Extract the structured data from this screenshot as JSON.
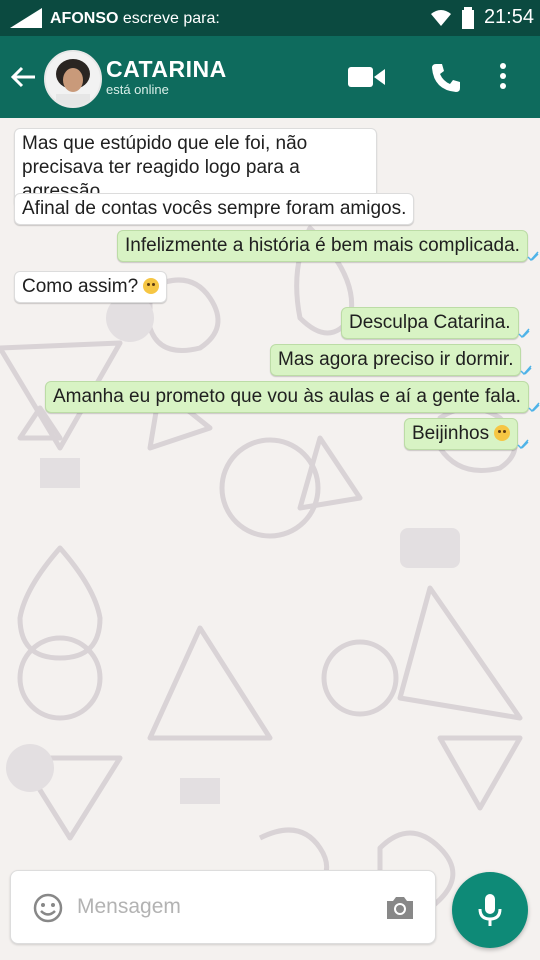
{
  "status_bar": {
    "writer_name": "AFONSO",
    "writer_suffix": "escreve para:",
    "time": "21:54"
  },
  "header": {
    "contact_name": "CATARINA",
    "contact_status": "está online"
  },
  "messages": [
    {
      "dir": "in",
      "line1": "Mas que estúpido que ele foi, não",
      "line2": "precisava ter reagido logo para a agressão"
    },
    {
      "dir": "in",
      "text": "Afinal de contas vocês sempre foram amigos."
    },
    {
      "dir": "out",
      "text": "Infelizmente a história é bem mais complicada."
    },
    {
      "dir": "in",
      "text": "Como assim?",
      "emoji": "flushed-face"
    },
    {
      "dir": "out",
      "text": "Desculpa Catarina."
    },
    {
      "dir": "out",
      "text": "Mas agora preciso ir dormir."
    },
    {
      "dir": "out",
      "text": "Amanha eu prometo que vou às aulas e aí a gente fala."
    },
    {
      "dir": "out",
      "text": "Beijinhos",
      "emoji": "kissing-face"
    }
  ],
  "input": {
    "placeholder": "Mensagem"
  },
  "colors": {
    "status_bar": "#0b4a40",
    "app_bar": "#0e6b5d",
    "outgoing_bubble": "#d8f3c4",
    "incoming_bubble": "#ffffff",
    "mic_button": "#0e8a77",
    "read_tick": "#4fb3e8"
  }
}
